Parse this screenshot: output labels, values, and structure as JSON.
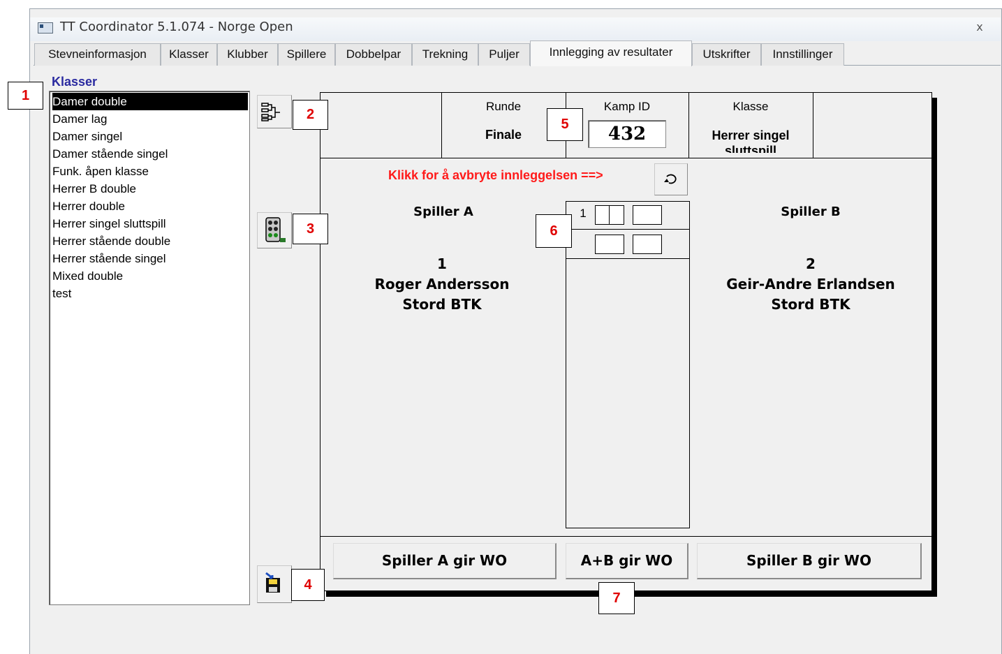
{
  "window": {
    "title": "TT Coordinator 5.1.074 - Norge Open",
    "close_glyph": "x"
  },
  "tabs": [
    {
      "label": "Stevneinformasjon"
    },
    {
      "label": "Klasser"
    },
    {
      "label": "Klubber"
    },
    {
      "label": "Spillere"
    },
    {
      "label": "Dobbelpar"
    },
    {
      "label": "Trekning"
    },
    {
      "label": "Puljer"
    },
    {
      "label": "Innlegging av resultater",
      "active": true
    },
    {
      "label": "Utskrifter"
    },
    {
      "label": "Innstillinger"
    }
  ],
  "sidebar": {
    "heading": "Klasser",
    "items": [
      {
        "label": "Damer double",
        "selected": true
      },
      {
        "label": "Damer lag"
      },
      {
        "label": "Damer singel"
      },
      {
        "label": "Damer stående singel"
      },
      {
        "label": "Funk. åpen klasse"
      },
      {
        "label": "Herrer B double"
      },
      {
        "label": "Herrer double"
      },
      {
        "label": "Herrer singel sluttspill"
      },
      {
        "label": "Herrer stående double"
      },
      {
        "label": "Herrer stående singel"
      },
      {
        "label": "Mixed double"
      },
      {
        "label": "test"
      }
    ]
  },
  "tools": {
    "draw_icon": "bracket-icon",
    "traffic_icon": "traffic-light-icon",
    "save_icon": "save-disk-icon"
  },
  "match": {
    "runde_label": "Runde",
    "runde_value": "Finale",
    "kamp_label": "Kamp ID",
    "kamp_value": "432",
    "klasse_label": "Klasse",
    "klasse_value": "Herrer singel sluttspill",
    "cancel_text": "Klikk for å avbryte innleggelsen ==>",
    "undo_icon": "undo-icon"
  },
  "player_a": {
    "heading": "Spiller A",
    "number": "1",
    "name": "Roger Andersson",
    "club": "Stord BTK"
  },
  "player_b": {
    "heading": "Spiller B",
    "number": "2",
    "name": "Geir-Andre Erlandsen",
    "club": "Stord BTK"
  },
  "score": {
    "set_number": "1"
  },
  "buttons": {
    "a_wo": "Spiller A gir WO",
    "ab_wo": "A+B gir WO",
    "b_wo": "Spiller B gir WO"
  },
  "callouts": [
    "1",
    "2",
    "3",
    "4",
    "5",
    "6",
    "7"
  ],
  "colors": {
    "heading_blue": "#2a2aa0",
    "cancel_red": "#ff1a1a",
    "callout_red": "#e00000"
  }
}
